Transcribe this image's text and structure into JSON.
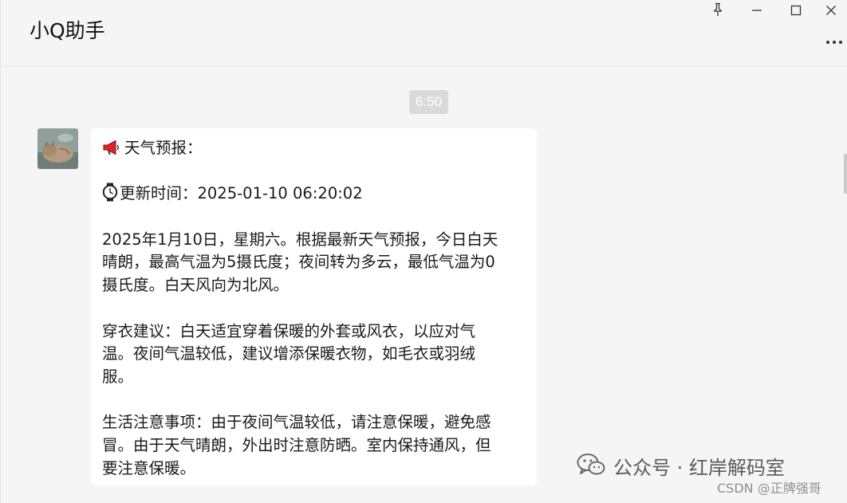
{
  "window": {
    "title": "小Q助手",
    "controls": {
      "pin": "pin-icon",
      "minimize": "minimize-icon",
      "maximize": "maximize-icon",
      "close": "close-icon",
      "more": "more-icon"
    }
  },
  "chat": {
    "timestamp": "6:50",
    "message": {
      "lines": [
        "天气预报：",
        "",
        "更新时间：2025-01-10 06:20:02",
        "",
        "2025年1月10日，星期六。根据最新天气预报，今日白天",
        "晴朗，最高气温为5摄氏度；夜间转为多云，最低气温为0",
        "摄氏度。白天风向为北风。",
        "",
        "穿衣建议：白天适宜穿着保暖的外套或风衣，以应对气",
        "温。夜间气温较低，建议增添保暖衣物，如毛衣或羽绒",
        "服。",
        "",
        "生活注意事项：由于夜间气温较低，请注意保暖，避免感",
        "冒。由于天气晴朗，外出时注意防晒。室内保持通风，但",
        "要注意保暖。"
      ],
      "icons": [
        "megaphone-icon",
        "watch-icon"
      ]
    }
  },
  "watermark": {
    "text": "公众号 · 红岸解码室",
    "credit": "CSDN @正牌强哥"
  },
  "colors": {
    "background": "#f5f5f5",
    "bubble": "#ffffff",
    "time_chip": "#dadada",
    "megaphone": "#e02424"
  }
}
